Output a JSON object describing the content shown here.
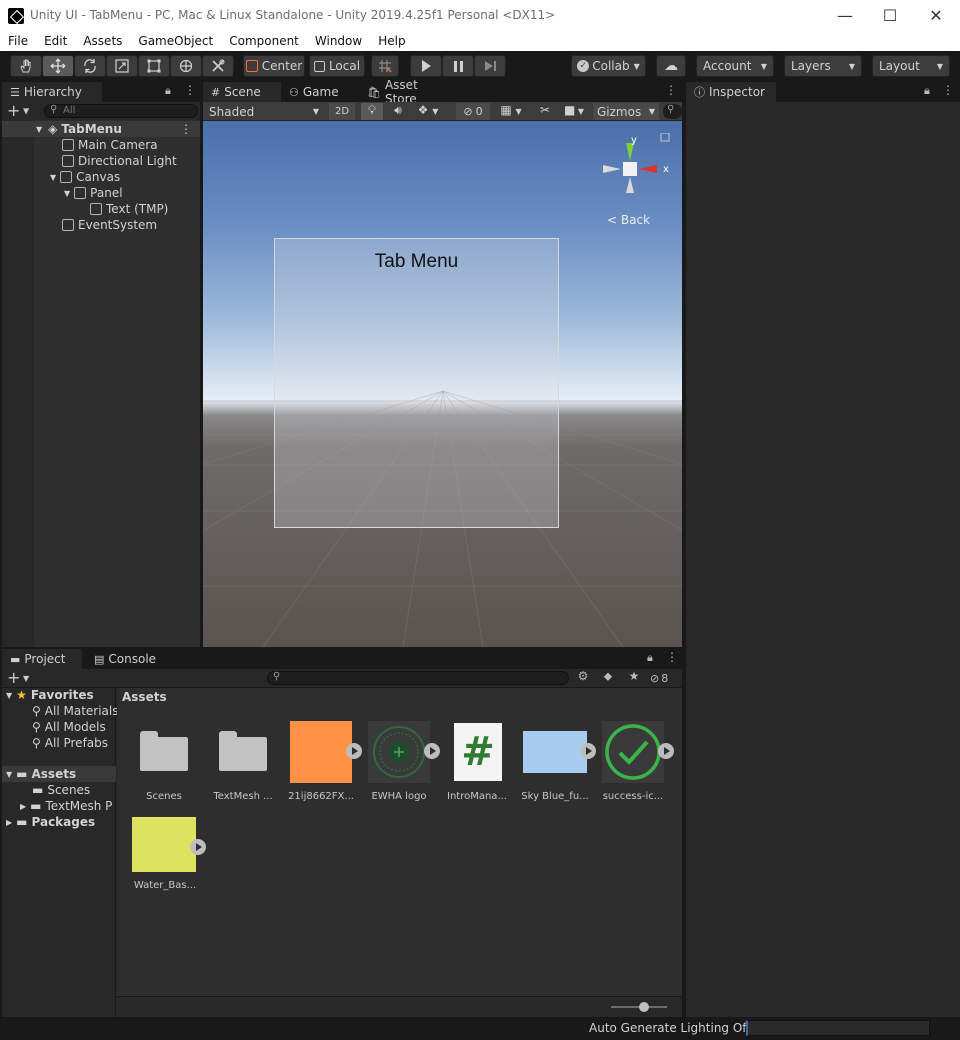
{
  "window": {
    "title": "Unity UI - TabMenu - PC, Mac & Linux Standalone - Unity 2019.4.25f1 Personal <DX11>",
    "minimize": "—",
    "maximize": "☐",
    "close": "✕"
  },
  "menubar": [
    "File",
    "Edit",
    "Assets",
    "GameObject",
    "Component",
    "Window",
    "Help"
  ],
  "toolbar": {
    "pivot": "Center",
    "space": "Local",
    "collab": "Collab",
    "account": "Account",
    "layers": "Layers",
    "layout": "Layout"
  },
  "hierarchy": {
    "tab": "Hierarchy",
    "search_placeholder": "All",
    "items": [
      {
        "label": "TabMenu"
      },
      {
        "label": "Main Camera"
      },
      {
        "label": "Directional Light"
      },
      {
        "label": "Canvas"
      },
      {
        "label": "Panel"
      },
      {
        "label": "Text (TMP)"
      },
      {
        "label": "EventSystem"
      }
    ]
  },
  "scene": {
    "tabs": [
      "Scene",
      "Game",
      "Asset Store"
    ],
    "shading": "Shaded",
    "mode_2d": "2D",
    "hidden_count": "0",
    "gizmos": "Gizmos",
    "panel_text": "Tab Menu",
    "gizmo_back": "Back",
    "axis_y": "y",
    "axis_x": "x"
  },
  "inspector": {
    "tab": "Inspector"
  },
  "project": {
    "tabs": [
      "Project",
      "Console"
    ],
    "hidden_count": "8",
    "breadcrumb": "Assets",
    "sidebar": {
      "favorites": "Favorites",
      "fav_items": [
        "All Materials",
        "All Models",
        "All Prefabs"
      ],
      "assets": "Assets",
      "asset_items": [
        "Scenes",
        "TextMesh P"
      ],
      "packages": "Packages"
    },
    "assets": [
      {
        "label": "Scenes",
        "kind": "folder"
      },
      {
        "label": "TextMesh ...",
        "kind": "folder"
      },
      {
        "label": "21ij8662FX...",
        "kind": "color",
        "color": "#ff9245"
      },
      {
        "label": "EWHA logo",
        "kind": "logo"
      },
      {
        "label": "IntroMana...",
        "kind": "script"
      },
      {
        "label": "Sky Blue_fu...",
        "kind": "color",
        "color": "#a8cbf0"
      },
      {
        "label": "success-ic...",
        "kind": "check"
      },
      {
        "label": "Water_Bas...",
        "kind": "color",
        "color": "#dde35e"
      }
    ]
  },
  "status": {
    "lighting": "Auto Generate Lighting Off"
  },
  "colors": {
    "accent_green": "#3ab54a",
    "script_green": "#2e7d32"
  }
}
